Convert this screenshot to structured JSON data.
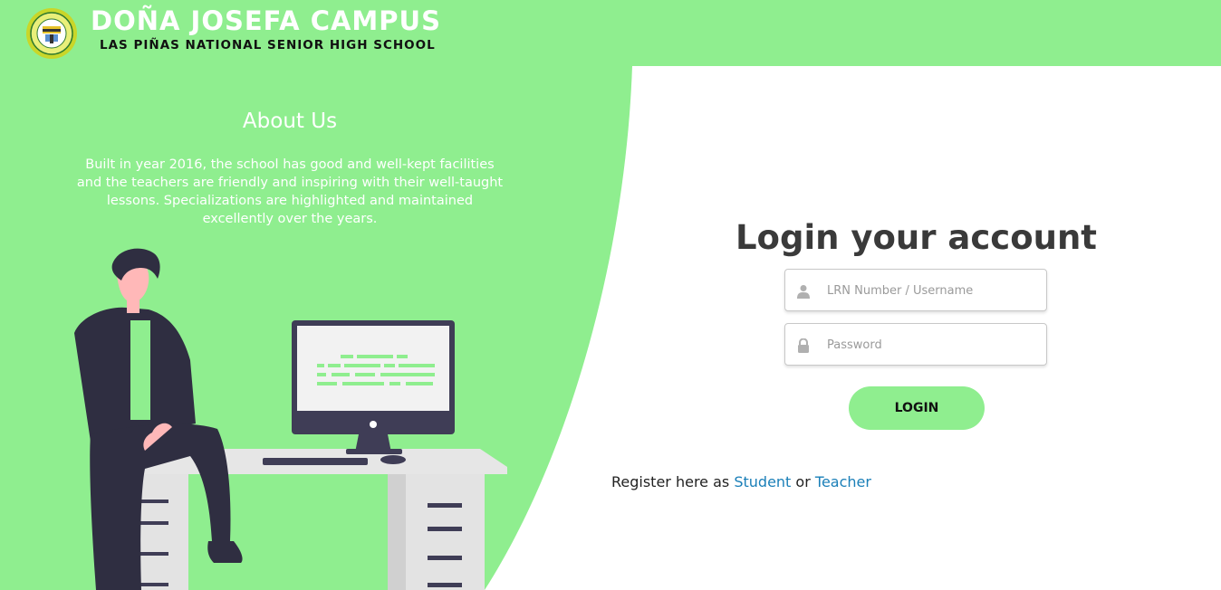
{
  "header": {
    "title": "DOÑA JOSEFA CAMPUS",
    "subtitle": "LAS PIÑAS NATIONAL SENIOR HIGH SCHOOL",
    "logo_icon": "school-seal-logo"
  },
  "about": {
    "title": "About Us",
    "body": "Built in year 2016, the school has good and well-kept facilities and the teachers are friendly and inspiring with their well-taught lessons. Specializations are highlighted and maintained excellently over the years."
  },
  "login": {
    "title": "Login your account",
    "username_placeholder": "LRN Number / Username",
    "username_value": "",
    "password_placeholder": "Password",
    "password_value": "",
    "username_icon": "user-icon",
    "password_icon": "lock-icon",
    "button_label": "LOGIN"
  },
  "register": {
    "prefix": "Register here as",
    "student_link": "Student",
    "connector": "or",
    "teacher_link": "Teacher"
  },
  "colors": {
    "brand_green": "#8fee8f",
    "link_blue": "#1a7fb8",
    "dark_text": "#3a3a3a"
  }
}
